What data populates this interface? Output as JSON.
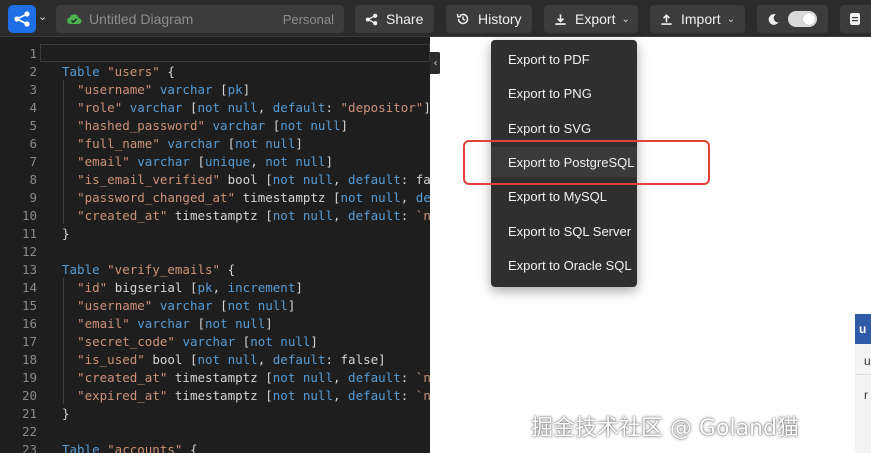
{
  "topbar": {
    "title": "Untitled Diagram",
    "workspace": "Personal",
    "share_label": "Share",
    "history_label": "History",
    "export_label": "Export",
    "import_label": "Import"
  },
  "editor": {
    "lines": [
      {
        "n": "1",
        "tokens": []
      },
      {
        "n": "2",
        "tokens": [
          {
            "c": "k",
            "t": "Table "
          },
          {
            "c": "s",
            "t": "\"users\""
          },
          {
            "c": "p",
            "t": " {"
          }
        ]
      },
      {
        "n": "3",
        "tokens": [
          {
            "c": "p",
            "t": "  "
          },
          {
            "c": "s",
            "t": "\"username\""
          },
          {
            "c": "p",
            "t": " "
          },
          {
            "c": "t",
            "t": "varchar"
          },
          {
            "c": "p",
            "t": " ["
          },
          {
            "c": "k",
            "t": "pk"
          },
          {
            "c": "p",
            "t": "]"
          }
        ]
      },
      {
        "n": "4",
        "tokens": [
          {
            "c": "p",
            "t": "  "
          },
          {
            "c": "s",
            "t": "\"role\""
          },
          {
            "c": "p",
            "t": " "
          },
          {
            "c": "t",
            "t": "varchar"
          },
          {
            "c": "p",
            "t": " ["
          },
          {
            "c": "k",
            "t": "not null"
          },
          {
            "c": "p",
            "t": ", "
          },
          {
            "c": "k",
            "t": "default"
          },
          {
            "c": "p",
            "t": ": "
          },
          {
            "c": "s",
            "t": "\"depositor\""
          },
          {
            "c": "p",
            "t": "]"
          }
        ]
      },
      {
        "n": "5",
        "tokens": [
          {
            "c": "p",
            "t": "  "
          },
          {
            "c": "s",
            "t": "\"hashed_password\""
          },
          {
            "c": "p",
            "t": " "
          },
          {
            "c": "t",
            "t": "varchar"
          },
          {
            "c": "p",
            "t": " ["
          },
          {
            "c": "k",
            "t": "not null"
          },
          {
            "c": "p",
            "t": "]"
          }
        ]
      },
      {
        "n": "6",
        "tokens": [
          {
            "c": "p",
            "t": "  "
          },
          {
            "c": "s",
            "t": "\"full_name\""
          },
          {
            "c": "p",
            "t": " "
          },
          {
            "c": "t",
            "t": "varchar"
          },
          {
            "c": "p",
            "t": " ["
          },
          {
            "c": "k",
            "t": "not null"
          },
          {
            "c": "p",
            "t": "]"
          }
        ]
      },
      {
        "n": "7",
        "tokens": [
          {
            "c": "p",
            "t": "  "
          },
          {
            "c": "s",
            "t": "\"email\""
          },
          {
            "c": "p",
            "t": " "
          },
          {
            "c": "t",
            "t": "varchar"
          },
          {
            "c": "p",
            "t": " ["
          },
          {
            "c": "k",
            "t": "unique"
          },
          {
            "c": "p",
            "t": ", "
          },
          {
            "c": "k",
            "t": "not null"
          },
          {
            "c": "p",
            "t": "]"
          }
        ]
      },
      {
        "n": "8",
        "tokens": [
          {
            "c": "p",
            "t": "  "
          },
          {
            "c": "s",
            "t": "\"is_email_verified\""
          },
          {
            "c": "p",
            "t": " "
          },
          {
            "c": "plain",
            "t": "bool"
          },
          {
            "c": "p",
            "t": " ["
          },
          {
            "c": "k",
            "t": "not null"
          },
          {
            "c": "p",
            "t": ", "
          },
          {
            "c": "k",
            "t": "default"
          },
          {
            "c": "p",
            "t": ": fals"
          }
        ]
      },
      {
        "n": "9",
        "tokens": [
          {
            "c": "p",
            "t": "  "
          },
          {
            "c": "s",
            "t": "\"password_changed_at\""
          },
          {
            "c": "p",
            "t": " "
          },
          {
            "c": "plain",
            "t": "timestamptz"
          },
          {
            "c": "p",
            "t": " ["
          },
          {
            "c": "k",
            "t": "not null"
          },
          {
            "c": "p",
            "t": ", "
          },
          {
            "c": "k",
            "t": "defa"
          }
        ]
      },
      {
        "n": "10",
        "tokens": [
          {
            "c": "p",
            "t": "  "
          },
          {
            "c": "s",
            "t": "\"created_at\""
          },
          {
            "c": "p",
            "t": " "
          },
          {
            "c": "plain",
            "t": "timestamptz"
          },
          {
            "c": "p",
            "t": " ["
          },
          {
            "c": "k",
            "t": "not null"
          },
          {
            "c": "p",
            "t": ", "
          },
          {
            "c": "k",
            "t": "default"
          },
          {
            "c": "p",
            "t": ": "
          },
          {
            "c": "s",
            "t": "`now"
          }
        ]
      },
      {
        "n": "11",
        "tokens": [
          {
            "c": "p",
            "t": "}"
          }
        ]
      },
      {
        "n": "12",
        "tokens": []
      },
      {
        "n": "13",
        "tokens": [
          {
            "c": "k",
            "t": "Table "
          },
          {
            "c": "s",
            "t": "\"verify_emails\""
          },
          {
            "c": "p",
            "t": " {"
          }
        ]
      },
      {
        "n": "14",
        "tokens": [
          {
            "c": "p",
            "t": "  "
          },
          {
            "c": "s",
            "t": "\"id\""
          },
          {
            "c": "p",
            "t": " "
          },
          {
            "c": "plain",
            "t": "bigserial"
          },
          {
            "c": "p",
            "t": " ["
          },
          {
            "c": "k",
            "t": "pk"
          },
          {
            "c": "p",
            "t": ", "
          },
          {
            "c": "k",
            "t": "increment"
          },
          {
            "c": "p",
            "t": "]"
          }
        ]
      },
      {
        "n": "15",
        "tokens": [
          {
            "c": "p",
            "t": "  "
          },
          {
            "c": "s",
            "t": "\"username\""
          },
          {
            "c": "p",
            "t": " "
          },
          {
            "c": "t",
            "t": "varchar"
          },
          {
            "c": "p",
            "t": " ["
          },
          {
            "c": "k",
            "t": "not null"
          },
          {
            "c": "p",
            "t": "]"
          }
        ]
      },
      {
        "n": "16",
        "tokens": [
          {
            "c": "p",
            "t": "  "
          },
          {
            "c": "s",
            "t": "\"email\""
          },
          {
            "c": "p",
            "t": " "
          },
          {
            "c": "t",
            "t": "varchar"
          },
          {
            "c": "p",
            "t": " ["
          },
          {
            "c": "k",
            "t": "not null"
          },
          {
            "c": "p",
            "t": "]"
          }
        ]
      },
      {
        "n": "17",
        "tokens": [
          {
            "c": "p",
            "t": "  "
          },
          {
            "c": "s",
            "t": "\"secret_code\""
          },
          {
            "c": "p",
            "t": " "
          },
          {
            "c": "t",
            "t": "varchar"
          },
          {
            "c": "p",
            "t": " ["
          },
          {
            "c": "k",
            "t": "not null"
          },
          {
            "c": "p",
            "t": "]"
          }
        ]
      },
      {
        "n": "18",
        "tokens": [
          {
            "c": "p",
            "t": "  "
          },
          {
            "c": "s",
            "t": "\"is_used\""
          },
          {
            "c": "p",
            "t": " "
          },
          {
            "c": "plain",
            "t": "bool"
          },
          {
            "c": "p",
            "t": " ["
          },
          {
            "c": "k",
            "t": "not null"
          },
          {
            "c": "p",
            "t": ", "
          },
          {
            "c": "k",
            "t": "default"
          },
          {
            "c": "p",
            "t": ": false]"
          }
        ]
      },
      {
        "n": "19",
        "tokens": [
          {
            "c": "p",
            "t": "  "
          },
          {
            "c": "s",
            "t": "\"created_at\""
          },
          {
            "c": "p",
            "t": " "
          },
          {
            "c": "plain",
            "t": "timestamptz"
          },
          {
            "c": "p",
            "t": " ["
          },
          {
            "c": "k",
            "t": "not null"
          },
          {
            "c": "p",
            "t": ", "
          },
          {
            "c": "k",
            "t": "default"
          },
          {
            "c": "p",
            "t": ": "
          },
          {
            "c": "s",
            "t": "`now"
          }
        ]
      },
      {
        "n": "20",
        "tokens": [
          {
            "c": "p",
            "t": "  "
          },
          {
            "c": "s",
            "t": "\"expired_at\""
          },
          {
            "c": "p",
            "t": " "
          },
          {
            "c": "plain",
            "t": "timestamptz"
          },
          {
            "c": "p",
            "t": " ["
          },
          {
            "c": "k",
            "t": "not null"
          },
          {
            "c": "p",
            "t": ", "
          },
          {
            "c": "k",
            "t": "default"
          },
          {
            "c": "p",
            "t": ": "
          },
          {
            "c": "s",
            "t": "`now"
          }
        ]
      },
      {
        "n": "21",
        "tokens": [
          {
            "c": "p",
            "t": "}"
          }
        ]
      },
      {
        "n": "22",
        "tokens": []
      },
      {
        "n": "23",
        "tokens": [
          {
            "c": "k",
            "t": "Table "
          },
          {
            "c": "s",
            "t": "\"accounts\""
          },
          {
            "c": "p",
            "t": " {"
          }
        ]
      }
    ]
  },
  "export_menu": {
    "items": [
      {
        "label": "Export to PDF"
      },
      {
        "label": "Export to PNG"
      },
      {
        "label": "Export to SVG"
      },
      {
        "label": "Export to PostgreSQL",
        "highlighted": true
      },
      {
        "label": "Export to MySQL"
      },
      {
        "label": "Export to SQL Server"
      },
      {
        "label": "Export to Oracle SQL"
      }
    ]
  },
  "canvas": {
    "table_header_fragment": "u",
    "table_row_fragments": [
      "u",
      "r"
    ]
  },
  "watermark": "掘金技术社区 @ Goland猫",
  "colors": {
    "accent": "#1e6fe5",
    "highlight_box": "#e0413a",
    "keyword": "#569cd6",
    "string": "#ce9178"
  }
}
